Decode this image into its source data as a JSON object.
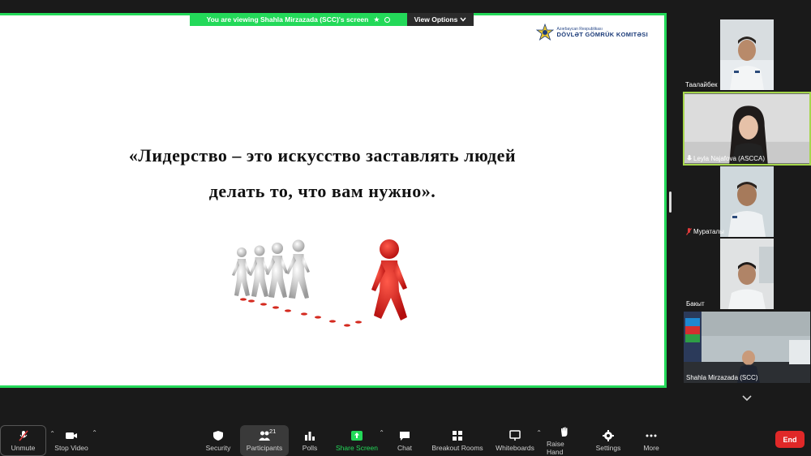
{
  "banner": {
    "viewing_text": "You are viewing  Shahla Mirzazada (SCC)'s screen",
    "view_options_label": "View Options"
  },
  "slide": {
    "logo_small": "Azərbaycan Respublikası",
    "logo_big": "DÖVLƏT GÖMRÜK KOMITƏSI",
    "quote_line1": "«Лидерство – это искусство заставлять людей",
    "quote_line2": "делать то, что вам нужно»."
  },
  "participants": [
    {
      "name": "Таалайбек",
      "muted": false
    },
    {
      "name": "Leyla Najafova (ASCCA)",
      "muted": false
    },
    {
      "name": "Мураталы",
      "muted": true
    },
    {
      "name": "Бакыт",
      "muted": false
    },
    {
      "name": "Shahla Mirzazada (SCC)",
      "muted": false
    }
  ],
  "toolbar": {
    "unmute": "Unmute",
    "stop_video": "Stop Video",
    "security": "Security",
    "participants": "Participants",
    "participants_count": "21",
    "polls": "Polls",
    "share_screen": "Share Screen",
    "chat": "Chat",
    "breakout_rooms": "Breakout Rooms",
    "whiteboards": "Whiteboards",
    "raise_hand": "Raise Hand",
    "settings": "Settings",
    "more": "More",
    "end": "End"
  },
  "colors": {
    "share_border": "#23d959",
    "active_speaker": "#a5d64b",
    "end_button": "#e02828",
    "toolbar_bg": "#1a1a1a"
  }
}
